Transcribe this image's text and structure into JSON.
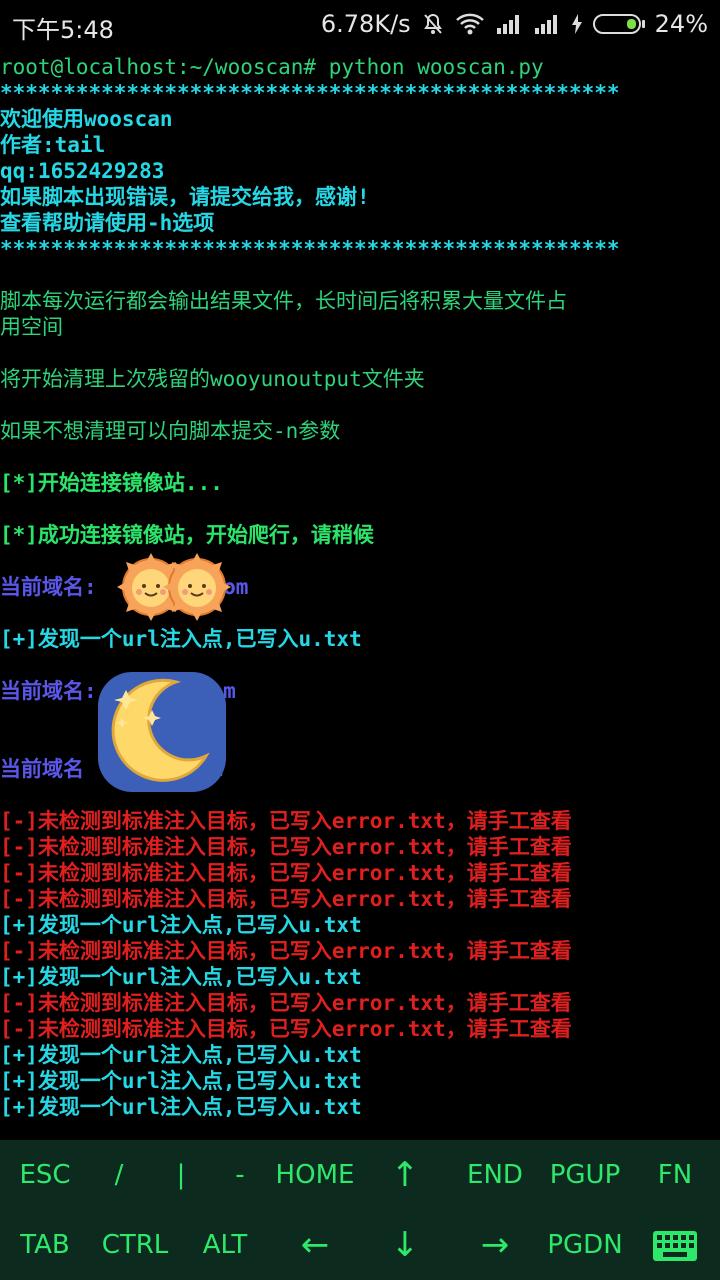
{
  "status": {
    "time": "下午5:48",
    "speed": "6.78K/s",
    "battery": "24%"
  },
  "terminal": {
    "lines": [
      {
        "text": "root@localhost:~/wooscan# python wooscan.py",
        "color": "#2ed37a"
      },
      {
        "text": "*************************************************",
        "color": "#26d8e6"
      },
      {
        "text": "欢迎使用wooscan",
        "color": "#26d8e6"
      },
      {
        "text": "作者:tail",
        "color": "#26d8e6"
      },
      {
        "text": "qq:1652429283",
        "color": "#26d8e6"
      },
      {
        "text": "如果脚本出现错误，请提交给我，感谢!",
        "color": "#26d8e6"
      },
      {
        "text": "查看帮助请使用-h选项",
        "color": "#26d8e6"
      },
      {
        "text": "*************************************************",
        "color": "#26d8e6"
      },
      {
        "text": "脚本每次运行都会输出结果文件，长时间后将积累大量文件占",
        "color": "#2ed37a"
      },
      {
        "text": "用空间",
        "color": "#2ed37a"
      },
      {
        "text": "将开始清理上次残留的wooyunoutput文件夹",
        "color": "#2ed37a"
      },
      {
        "text": "如果不想清理可以向脚本提交-n参数",
        "color": "#2ed37a"
      },
      {
        "text": "[*]开始连接镜像站...",
        "color": "#2be46a"
      },
      {
        "text": "[*]成功连接镜像站，开始爬行，请稍候",
        "color": "#2be46a"
      },
      {
        "text": "当前域名:        .com",
        "color": "#5a57e8"
      },
      {
        "text": "[+]发现一个url注入点,已写入u.txt",
        "color": "#26d8e6"
      },
      {
        "text": "当前域名:      n.com",
        "color": "#5a57e8"
      },
      {
        "text": "当前域名       .com",
        "color": "#5a57e8"
      },
      {
        "text": "[-]未检测到标准注入目标，已写入error.txt，请手工查看",
        "color": "#e01f1f"
      },
      {
        "text": "[-]未检测到标准注入目标，已写入error.txt，请手工查看",
        "color": "#e01f1f"
      },
      {
        "text": "[-]未检测到标准注入目标，已写入error.txt，请手工查看",
        "color": "#e01f1f"
      },
      {
        "text": "[-]未检测到标准注入目标，已写入error.txt，请手工查看",
        "color": "#e01f1f"
      },
      {
        "text": "[+]发现一个url注入点,已写入u.txt",
        "color": "#26d8e6"
      },
      {
        "text": "[-]未检测到标准注入目标，已写入error.txt，请手工查看",
        "color": "#e01f1f"
      },
      {
        "text": "[+]发现一个url注入点,已写入u.txt",
        "color": "#26d8e6"
      },
      {
        "text": "[-]未检测到标准注入目标，已写入error.txt，请手工查看",
        "color": "#e01f1f"
      },
      {
        "text": "[-]未检测到标准注入目标，已写入error.txt，请手工查看",
        "color": "#e01f1f"
      },
      {
        "text": "[+]发现一个url注入点,已写入u.txt",
        "color": "#26d8e6"
      },
      {
        "text": "[+]发现一个url注入点,已写入u.txt",
        "color": "#26d8e6"
      },
      {
        "text": "[+]发现一个url注入点,已写入u.txt",
        "color": "#26d8e6"
      }
    ]
  },
  "keys": {
    "row1": [
      "ESC",
      "/",
      "|",
      "-",
      "HOME",
      "↑",
      "END",
      "PGUP",
      "FN"
    ],
    "row2": [
      "TAB",
      "CTRL",
      "ALT",
      "←",
      "↓",
      "→",
      "PGDN"
    ],
    "keyboard_icon": "keyboard-icon"
  }
}
